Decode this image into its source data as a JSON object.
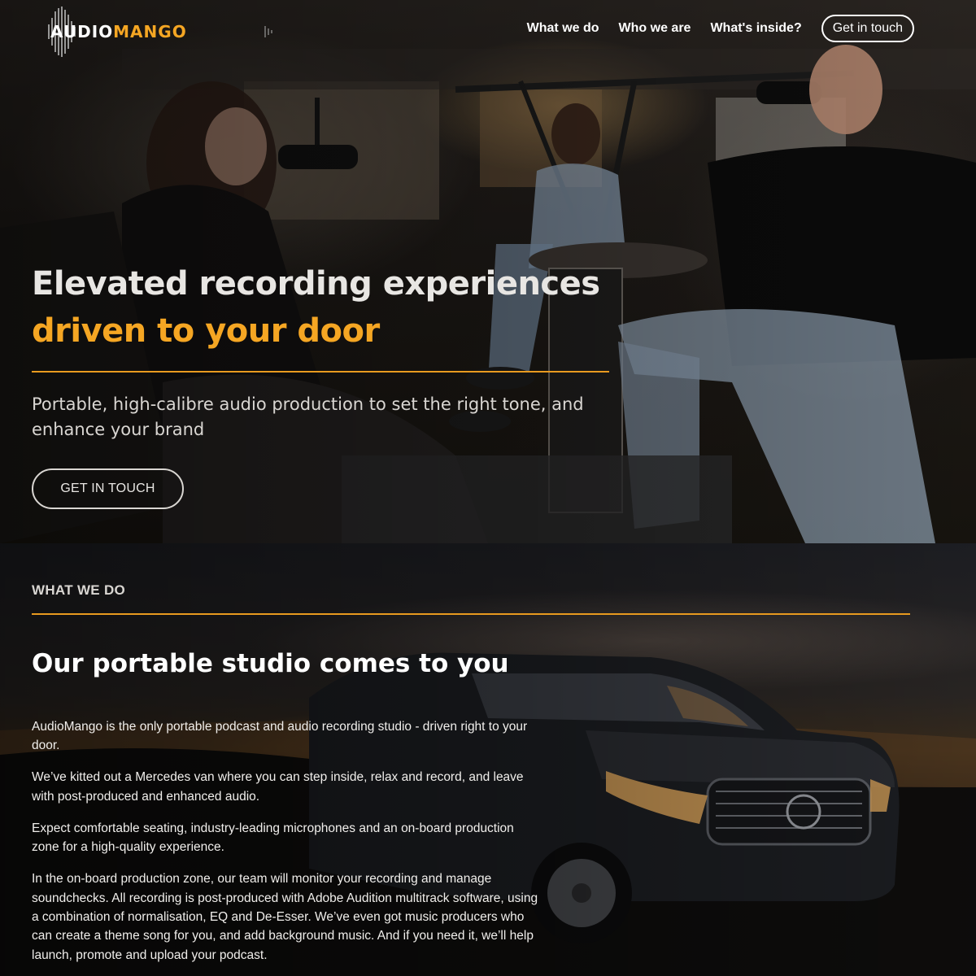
{
  "header": {
    "logo": {
      "part1": "AUDIO",
      "part2": "MANGO"
    },
    "nav": [
      {
        "label": "What we do"
      },
      {
        "label": "Who we are"
      },
      {
        "label": "What's inside?"
      }
    ],
    "cta_label": "Get in touch"
  },
  "hero": {
    "title_line1": "Elevated recording experiences",
    "title_line2": "driven to your door",
    "subtitle": "Portable, high-calibre audio production to set the right tone, and enhance your brand",
    "button_label": "GET IN TOUCH"
  },
  "what_we_do": {
    "eyebrow": "WHAT WE DO",
    "title": "Our portable studio comes to you",
    "paragraphs": [
      "AudioMango is the only portable podcast and audio recording studio - driven right to your door.",
      "We’ve kitted out a Mercedes van where you can step inside, relax and record, and leave with post-produced and enhanced audio.",
      "Expect comfortable seating, industry-leading microphones and an on-board production zone for a high-quality experience.",
      "In the on-board production zone, our team will monitor your recording and manage soundchecks. All recording is post-produced with Adobe Audition multitrack software, using a combination of normalisation, EQ and De-Esser. We’ve even got music producers who can create a theme song for you, and add background music. And if you need it, we’ll help launch, promote and upload your podcast."
    ]
  },
  "colors": {
    "accent": "#f5a623",
    "rule": "#e89a1f",
    "text_light": "#d9d6d2"
  },
  "icons": {
    "logo_mark": "sound-wave-icon"
  }
}
